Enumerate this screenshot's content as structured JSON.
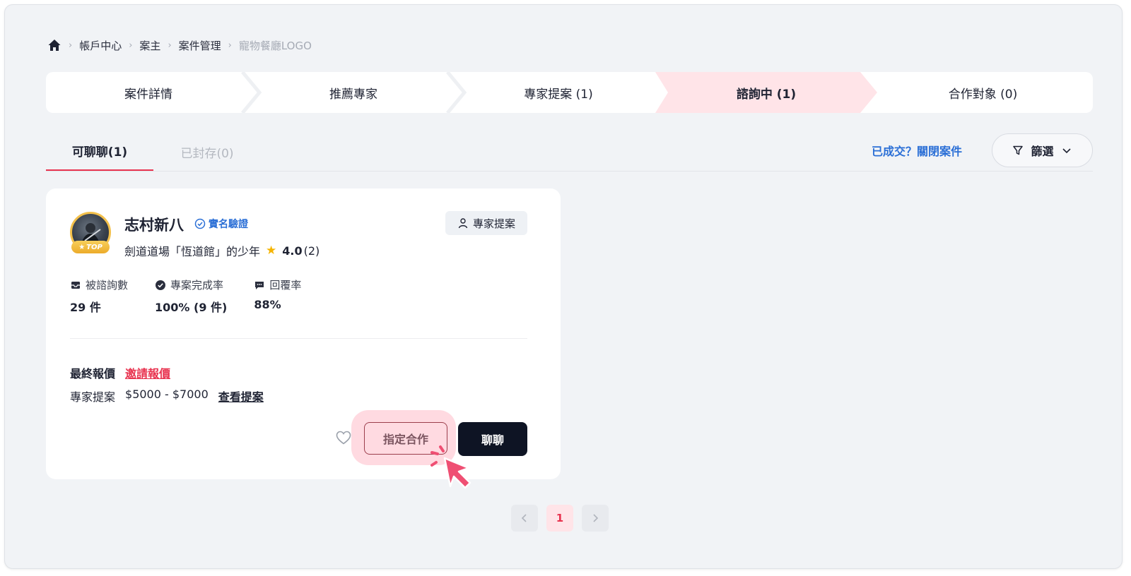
{
  "breadcrumb": {
    "items": [
      "帳戶中心",
      "案主",
      "案件管理"
    ],
    "current": "寵物餐廳LOGO"
  },
  "steps": [
    {
      "label": "案件詳情"
    },
    {
      "label": "推薦專家"
    },
    {
      "label": "專家提案 (1)"
    },
    {
      "label": "諮詢中 (1)"
    },
    {
      "label": "合作對象 (0)"
    }
  ],
  "tabs": [
    {
      "label": "可聊聊(1)"
    },
    {
      "label": "已封存(0)"
    }
  ],
  "toolbar": {
    "close_case": "已成交？關閉案件",
    "filter": "篩選"
  },
  "card": {
    "badge": "TOP",
    "name": "志村新八",
    "verified": "實名驗證",
    "proposal_tag": "專家提案",
    "bio": "劍道道場「恆道館」的少年",
    "rating": "4.0",
    "rating_count": "(2)",
    "stats": [
      {
        "label": "被諮詢數",
        "value": "29 件"
      },
      {
        "label": "專案完成率",
        "value": "100% (9 件)"
      },
      {
        "label": "回覆率",
        "value": "88%"
      }
    ],
    "final_quote_label": "最終報價",
    "invite_quote": "邀請報價",
    "proposal_label": "專家提案",
    "proposal_range": "$5000 - $7000",
    "view_proposal": "查看提案",
    "assign_button": "指定合作",
    "chat_button": "聊聊"
  },
  "pagination": {
    "current": "1"
  },
  "colors": {
    "accent": "#e8334f",
    "active_step_bg": "#ffe4e8",
    "link_blue": "#2b6fd6",
    "dark_button": "#0e1424"
  }
}
